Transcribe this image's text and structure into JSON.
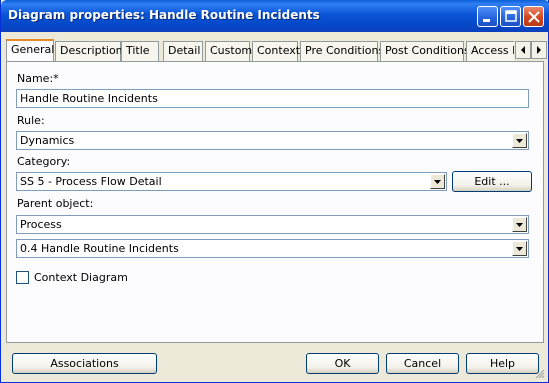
{
  "window": {
    "title": "Diagram properties: Handle Routine Incidents",
    "controls": [
      "minimize-icon",
      "maximize-icon",
      "close-icon"
    ]
  },
  "tabs": [
    {
      "label": "General",
      "active": true
    },
    {
      "label": "Description"
    },
    {
      "label": "Title"
    },
    {
      "label": "Detail"
    },
    {
      "label": "Custom"
    },
    {
      "label": "Context"
    },
    {
      "label": "Pre Conditions"
    },
    {
      "label": "Post Conditions"
    },
    {
      "label": "Access P"
    }
  ],
  "form": {
    "name_label": "Name:*",
    "name_value": "Handle Routine Incidents",
    "rule_label": "Rule:",
    "rule_value": "Dynamics",
    "category_label": "Category:",
    "category_value": "SS 5 - Process Flow Detail",
    "edit_button": "Edit ...",
    "parent_label": "Parent object:",
    "parent_type_value": "Process",
    "parent_object_value": "0.4 Handle Routine Incidents",
    "context_diagram_label": "Context Diagram",
    "context_diagram_checked": false
  },
  "buttons": {
    "associations": "Associations",
    "ok": "OK",
    "cancel": "Cancel",
    "help": "Help"
  },
  "colors": {
    "titlebar": "#0a55d6",
    "dialog_bg": "#ece9d8",
    "active_tab_accent": "#e68b2c"
  }
}
